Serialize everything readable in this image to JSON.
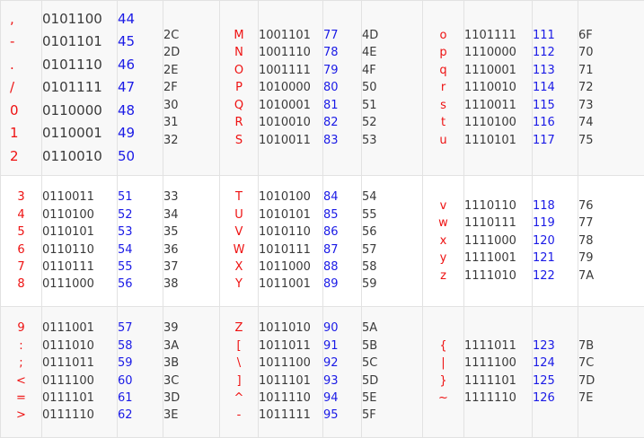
{
  "rows": [
    {
      "groups": [
        {
          "chars": [
            ",",
            "-",
            ".",
            "/",
            "0",
            "1",
            "2"
          ],
          "bin": [
            "0101100",
            "0101101",
            "0101110",
            "0101111",
            "0110000",
            "0110001",
            "0110010"
          ],
          "dec": [
            "44",
            "45",
            "46",
            "47",
            "48",
            "49",
            "50"
          ],
          "hex": [
            "2C",
            "2D",
            "2E",
            "2F",
            "30",
            "31",
            "32"
          ]
        },
        {
          "chars": [
            "M",
            "N",
            "O",
            "P",
            "Q",
            "R",
            "S"
          ],
          "bin": [
            "1001101",
            "1001110",
            "1001111",
            "1010000",
            "1010001",
            "1010010",
            "1010011"
          ],
          "dec": [
            "77",
            "78",
            "79",
            "80",
            "81",
            "82",
            "83"
          ],
          "hex": [
            "4D",
            "4E",
            "4F",
            "50",
            "51",
            "52",
            "53"
          ]
        },
        {
          "chars": [
            "o",
            "p",
            "q",
            "r",
            "s",
            "t",
            "u"
          ],
          "bin": [
            "1101111",
            "1110000",
            "1110001",
            "1110010",
            "1110011",
            "1110100",
            "1110101"
          ],
          "dec": [
            "111",
            "112",
            "113",
            "114",
            "115",
            "116",
            "117"
          ],
          "hex": [
            "6F",
            "70",
            "71",
            "72",
            "73",
            "74",
            "75"
          ]
        }
      ]
    },
    {
      "groups": [
        {
          "chars": [
            "3",
            "4",
            "5",
            "6",
            "7",
            "8"
          ],
          "bin": [
            "0110011",
            "0110100",
            "0110101",
            "0110110",
            "0110111",
            "0111000"
          ],
          "dec": [
            "51",
            "52",
            "53",
            "54",
            "55",
            "56"
          ],
          "hex": [
            "33",
            "34",
            "35",
            "36",
            "37",
            "38"
          ]
        },
        {
          "chars": [
            "T",
            "U",
            "V",
            "W",
            "X",
            "Y"
          ],
          "bin": [
            "1010100",
            "1010101",
            "1010110",
            "1010111",
            "1011000",
            "1011001"
          ],
          "dec": [
            "84",
            "85",
            "86",
            "87",
            "88",
            "89"
          ],
          "hex": [
            "54",
            "55",
            "56",
            "57",
            "58",
            "59"
          ]
        },
        {
          "chars": [
            "v",
            "w",
            "x",
            "y",
            "z"
          ],
          "bin": [
            "1110110",
            "1110111",
            "1111000",
            "1111001",
            "1111010"
          ],
          "dec": [
            "118",
            "119",
            "120",
            "121",
            "122"
          ],
          "hex": [
            "76",
            "77",
            "78",
            "79",
            "7A"
          ]
        }
      ]
    },
    {
      "groups": [
        {
          "chars": [
            "9",
            ":",
            ";",
            "<",
            "=",
            ">"
          ],
          "bin": [
            "0111001",
            "0111010",
            "0111011",
            "0111100",
            "0111101",
            "0111110"
          ],
          "dec": [
            "57",
            "58",
            "59",
            "60",
            "61",
            "62"
          ],
          "hex": [
            "39",
            "3A",
            "3B",
            "3C",
            "3D",
            "3E"
          ]
        },
        {
          "chars": [
            "Z",
            "[",
            "\\",
            "]",
            "^",
            "-"
          ],
          "bin": [
            "1011010",
            "1011011",
            "1011100",
            "1011101",
            "1011110",
            "1011111"
          ],
          "dec": [
            "90",
            "91",
            "92",
            "93",
            "94",
            "95"
          ],
          "hex": [
            "5A",
            "5B",
            "5C",
            "5D",
            "5E",
            "5F"
          ]
        },
        {
          "chars": [
            "{",
            "|",
            "}",
            "~"
          ],
          "bin": [
            "1111011",
            "1111100",
            "1111101",
            "1111110"
          ],
          "dec": [
            "123",
            "124",
            "125",
            "126"
          ],
          "hex": [
            "7B",
            "7C",
            "7D",
            "7E"
          ]
        }
      ]
    }
  ]
}
